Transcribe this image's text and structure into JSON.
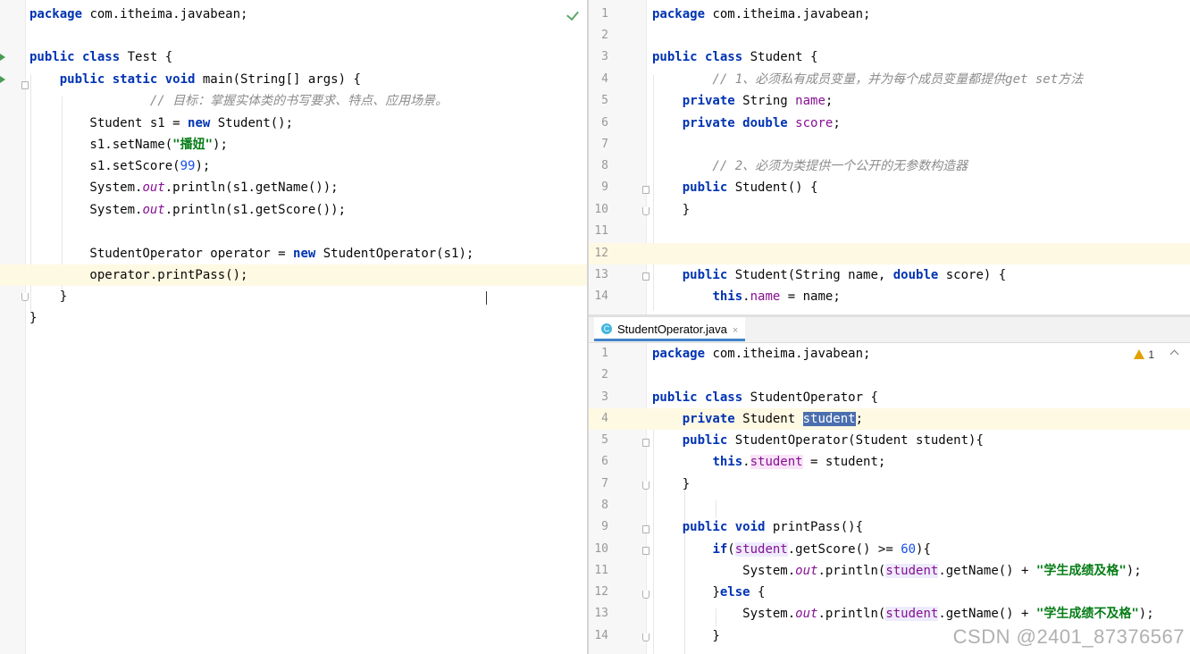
{
  "left_editor": {
    "lines": [
      "package com.itheima.javabean;",
      "",
      "public class Test {",
      "    public static void main(String[] args) {",
      "        // 目标：掌握实体类的书写要求、特点、应用场景。",
      "        Student s1 = new Student();",
      "        s1.setName(\"播妞\");",
      "        s1.setScore(99);",
      "        System.out.println(s1.getName());",
      "        System.out.println(s1.getScore());",
      "",
      "        StudentOperator operator = new StudentOperator(s1);",
      "        operator.printPass();",
      "    }",
      "}"
    ]
  },
  "right_top_editor": {
    "line_numbers": [
      "1",
      "2",
      "3",
      "4",
      "5",
      "6",
      "7",
      "8",
      "9",
      "10",
      "11",
      "12",
      "13",
      "14"
    ],
    "lines": [
      "package com.itheima.javabean;",
      "",
      "public class Student {",
      "    // 1、必须私有成员变量，并为每个成员变量都提供get set方法",
      "    private String name;",
      "    private double score;",
      "",
      "    // 2、必须为类提供一个公开的无参数构造器",
      "    public Student() {",
      "    }",
      "",
      "",
      "    public Student(String name, double score) {",
      "        this.name = name;"
    ]
  },
  "right_bottom_editor": {
    "tab_label": "StudentOperator.java",
    "tab_close": "×",
    "class_icon_letter": "C",
    "warning_count": "1",
    "line_numbers": [
      "1",
      "2",
      "3",
      "4",
      "5",
      "6",
      "7",
      "8",
      "9",
      "10",
      "11",
      "12",
      "13",
      "14"
    ],
    "lines": [
      "package com.itheima.javabean;",
      "",
      "public class StudentOperator {",
      "    private Student student;",
      "    public StudentOperator(Student student){",
      "        this.student = student;",
      "    }",
      "",
      "    public void printPass(){",
      "        if(student.getScore() >= 60){",
      "            System.out.println(student.getName() + \"学生成绩及格\");",
      "        }else {",
      "            System.out.println(student.getName() + \"学生成绩不及格\");",
      "        }"
    ]
  },
  "watermark": "CSDN @2401_87376567",
  "colors": {
    "keyword": "#0033b3",
    "comment": "#8c8c8c",
    "string": "#067d17",
    "number": "#1750eb",
    "field": "#871094",
    "current_line": "#fef9e3",
    "selection": "#4b6eaf"
  }
}
